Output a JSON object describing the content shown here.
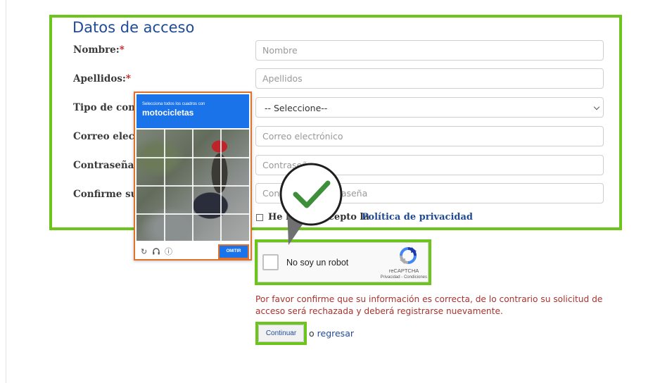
{
  "form": {
    "section_title": "Datos de acceso",
    "required_mark": "*",
    "fields": [
      {
        "label": "Nombre:",
        "placeholder": "Nombre"
      },
      {
        "label": "Apellidos:",
        "placeholder": "Apellidos"
      },
      {
        "label": "Tipo de conta",
        "selected": "-- Seleccione--"
      },
      {
        "label": "Correo electr",
        "placeholder": "Correo electrónico"
      },
      {
        "label": "Contraseña:",
        "placeholder": "Contraseña"
      },
      {
        "label": "Confirme su c",
        "placeholder": "Confirme su contraseña"
      }
    ],
    "privacy": {
      "text": "He leído y acepto la",
      "link": "Política de privacidad"
    }
  },
  "captcha_challenge": {
    "instruction": "Selecciona todos los cuadros con",
    "target": "motocicletas",
    "reload_icon": "↻",
    "audio_icon": "headphones-icon",
    "info_icon": "ⓘ",
    "skip_label": "OMITIR"
  },
  "recaptcha": {
    "checkbox_label": "No soy un robot",
    "brand": "reCAPTCHA",
    "terms": "Privacidad - Condiciones"
  },
  "notice": "Por favor confirme que su información es correcta, de lo contrario su solicitud de acceso será rechazada y deberá registrarse nuevamente.",
  "actions": {
    "continue_label": "Continuar",
    "or_text": "o",
    "return_link": "regresar"
  },
  "colors": {
    "highlight": "#6cc41c",
    "brand_blue": "#1f4a96",
    "required": "#c41e1e",
    "notice": "#a8332f",
    "captcha_blue": "#1a73e8",
    "captcha_border": "#e07230"
  }
}
